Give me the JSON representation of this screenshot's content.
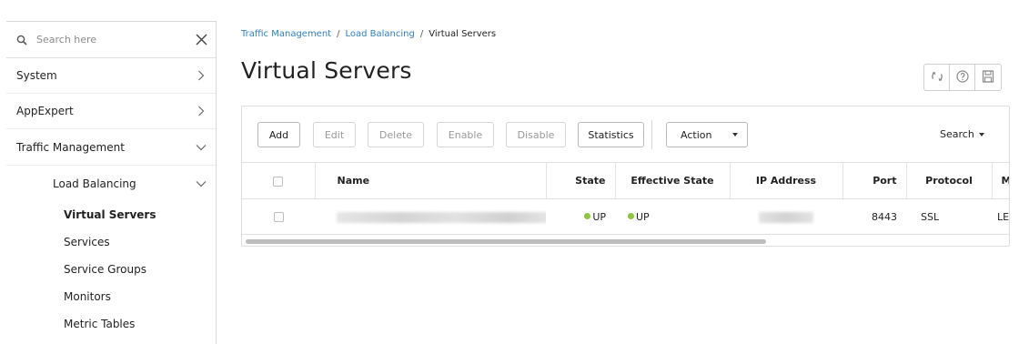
{
  "sidebar": {
    "search_placeholder": "Search here",
    "items": [
      {
        "label": "System"
      },
      {
        "label": "AppExpert"
      },
      {
        "label": "Traffic Management"
      },
      {
        "label": "Load Balancing"
      },
      {
        "label": "Virtual Servers"
      },
      {
        "label": "Services"
      },
      {
        "label": "Service Groups"
      },
      {
        "label": "Monitors"
      },
      {
        "label": "Metric Tables"
      }
    ]
  },
  "breadcrumb": {
    "items": [
      "Traffic Management",
      "Load Balancing",
      "Virtual Servers"
    ],
    "separator": "/"
  },
  "page": {
    "title": "Virtual Servers"
  },
  "toolbar": {
    "add": "Add",
    "edit": "Edit",
    "delete": "Delete",
    "enable": "Enable",
    "disable": "Disable",
    "statistics": "Statistics",
    "action": "Action",
    "search": "Search"
  },
  "table": {
    "columns": [
      "Name",
      "State",
      "Effective State",
      "IP Address",
      "Port",
      "Protocol",
      "Meth"
    ],
    "rows": [
      {
        "name": "",
        "state": "UP",
        "effective_state": "UP",
        "ip_address": "",
        "port": "8443",
        "protocol": "SSL",
        "method": "LEASTC"
      }
    ]
  },
  "colors": {
    "link": "#2f7fc1",
    "status_up": "#8cc63f",
    "border": "#d9d9d9"
  },
  "icons": {
    "refresh": "refresh-icon",
    "help": "help-icon",
    "save": "save-icon"
  }
}
